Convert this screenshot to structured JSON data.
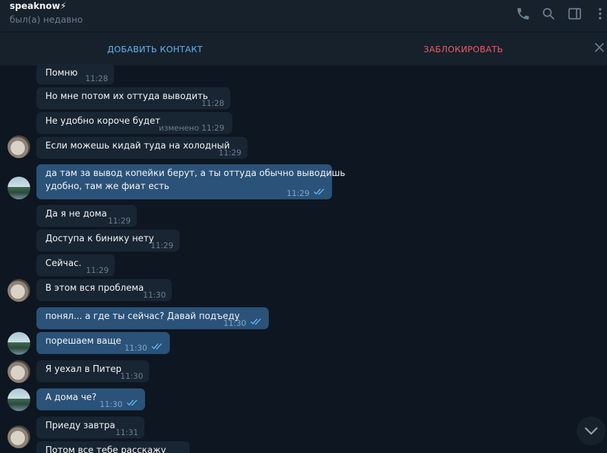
{
  "header": {
    "contact_name": "speaknow⚡",
    "status": "был(а) недавно"
  },
  "actionbar": {
    "add_contact": "ДОБАВИТЬ КОНТАКТ",
    "block": "ЗАБЛОКИРОВАТЬ"
  },
  "messages": [
    {
      "text": "Помню",
      "time": "11:28"
    },
    {
      "text": "Но мне потом их оттуда выводить",
      "time": "11:28"
    },
    {
      "text": "Не удобно короче будет",
      "time": "изменено 11:29"
    },
    {
      "text": "Если можешь кидай туда на холодный",
      "time": "11:29"
    },
    {
      "text_line1": "да там за вывод копейки берут, а ты оттуда обычно выводишь",
      "text_line2": "удобно, там же фиат есть",
      "time": "11:29"
    },
    {
      "text": "Да я не дома",
      "time": "11:29"
    },
    {
      "text": "Доступа к бинику нету",
      "time": "11:29"
    },
    {
      "text": "Сейчас.",
      "time": "11:29"
    },
    {
      "text": "В этом вся проблема",
      "time": "11:30"
    },
    {
      "text": "понял... а где ты сейчас? Давай подъеду",
      "time": "11:30"
    },
    {
      "text": "порешаем ваще",
      "time": "11:30"
    },
    {
      "text": "Я уехал в Питер",
      "time": "11:30"
    },
    {
      "text": "А дома че?",
      "time": "11:30"
    },
    {
      "text": "Приеду завтра",
      "time": "11:31"
    },
    {
      "text": "Потом все тебе расскажу",
      "time": ""
    }
  ],
  "colors": {
    "background": "#0e1621",
    "header": "#17212b",
    "incoming_bubble": "#182533",
    "outgoing_bubble": "#2b5278",
    "accent": "#5eb5f7",
    "danger": "#ec5e5e"
  },
  "icons": [
    "phone-icon",
    "search-icon",
    "sidebar-toggle-icon",
    "more-vertical-icon",
    "close-icon",
    "double-check-icon",
    "chevron-down-icon"
  ]
}
